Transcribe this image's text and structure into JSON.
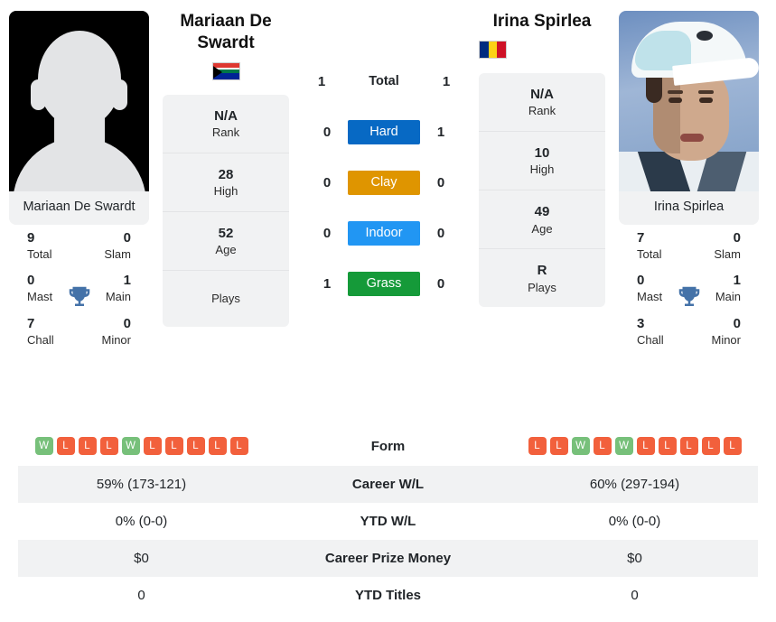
{
  "players": {
    "left": {
      "name": "Mariaan De Swardt",
      "photo_caption": "Mariaan De Swardt",
      "photo_type": "placeholder-silhouette",
      "country": "South Africa",
      "flag_icon": "flag-south-africa-icon",
      "rank": {
        "value": "N/A",
        "label": "Rank"
      },
      "high": {
        "value": "28",
        "label": "High"
      },
      "age": {
        "value": "52",
        "label": "Age"
      },
      "plays": {
        "value": "",
        "label": "Plays"
      },
      "titles": {
        "total": {
          "value": "9",
          "label": "Total"
        },
        "slam": {
          "value": "0",
          "label": "Slam"
        },
        "mast": {
          "value": "0",
          "label": "Mast"
        },
        "main": {
          "value": "1",
          "label": "Main"
        },
        "chall": {
          "value": "7",
          "label": "Chall"
        },
        "minor": {
          "value": "0",
          "label": "Minor"
        }
      },
      "form": [
        "W",
        "L",
        "L",
        "L",
        "W",
        "L",
        "L",
        "L",
        "L",
        "L"
      ],
      "career_wl": "59% (173-121)",
      "ytd_wl": "0% (0-0)",
      "career_prize_money": "$0",
      "ytd_titles": "0"
    },
    "right": {
      "name": "Irina Spirlea",
      "photo_caption": "Irina Spirlea",
      "photo_type": "photograph",
      "country": "Romania",
      "flag_icon": "flag-romania-icon",
      "rank": {
        "value": "N/A",
        "label": "Rank"
      },
      "high": {
        "value": "10",
        "label": "High"
      },
      "age": {
        "value": "49",
        "label": "Age"
      },
      "plays": {
        "value": "R",
        "label": "Plays"
      },
      "titles": {
        "total": {
          "value": "7",
          "label": "Total"
        },
        "slam": {
          "value": "0",
          "label": "Slam"
        },
        "mast": {
          "value": "0",
          "label": "Mast"
        },
        "main": {
          "value": "1",
          "label": "Main"
        },
        "chall": {
          "value": "3",
          "label": "Chall"
        },
        "minor": {
          "value": "0",
          "label": "Minor"
        }
      },
      "form": [
        "L",
        "L",
        "W",
        "L",
        "W",
        "L",
        "L",
        "L",
        "L",
        "L"
      ],
      "career_wl": "60% (297-194)",
      "ytd_wl": "0% (0-0)",
      "career_prize_money": "$0",
      "ytd_titles": "0"
    }
  },
  "head_to_head": {
    "rows": [
      {
        "label": "Total",
        "left": "1",
        "right": "1",
        "badge": false,
        "color": ""
      },
      {
        "label": "Hard",
        "left": "0",
        "right": "1",
        "badge": true,
        "color": "#0769c4"
      },
      {
        "label": "Clay",
        "left": "0",
        "right": "0",
        "badge": true,
        "color": "#df9500"
      },
      {
        "label": "Indoor",
        "left": "0",
        "right": "0",
        "badge": true,
        "color": "#2196f3"
      },
      {
        "label": "Grass",
        "left": "1",
        "right": "0",
        "badge": true,
        "color": "#159a39"
      }
    ]
  },
  "comparison_table": {
    "rows": [
      {
        "label": "Form",
        "left": "",
        "right": "",
        "type": "form"
      },
      {
        "label": "Career W/L",
        "left": "59% (173-121)",
        "right": "60% (297-194)",
        "type": "text"
      },
      {
        "label": "YTD W/L",
        "left": "0% (0-0)",
        "right": "0% (0-0)",
        "type": "text"
      },
      {
        "label": "Career Prize Money",
        "left": "$0",
        "right": "$0",
        "type": "text"
      },
      {
        "label": "YTD Titles",
        "left": "0",
        "right": "0",
        "type": "text"
      }
    ]
  },
  "icons": {
    "trophy": "trophy-icon",
    "trophy_color": "#4472a8"
  },
  "colors": {
    "hard": "#0769c4",
    "clay": "#df9500",
    "indoor": "#2196f3",
    "grass": "#159a39",
    "win_badge": "#77c07a",
    "loss_badge": "#f2603c",
    "card_bg": "#f1f2f3"
  }
}
